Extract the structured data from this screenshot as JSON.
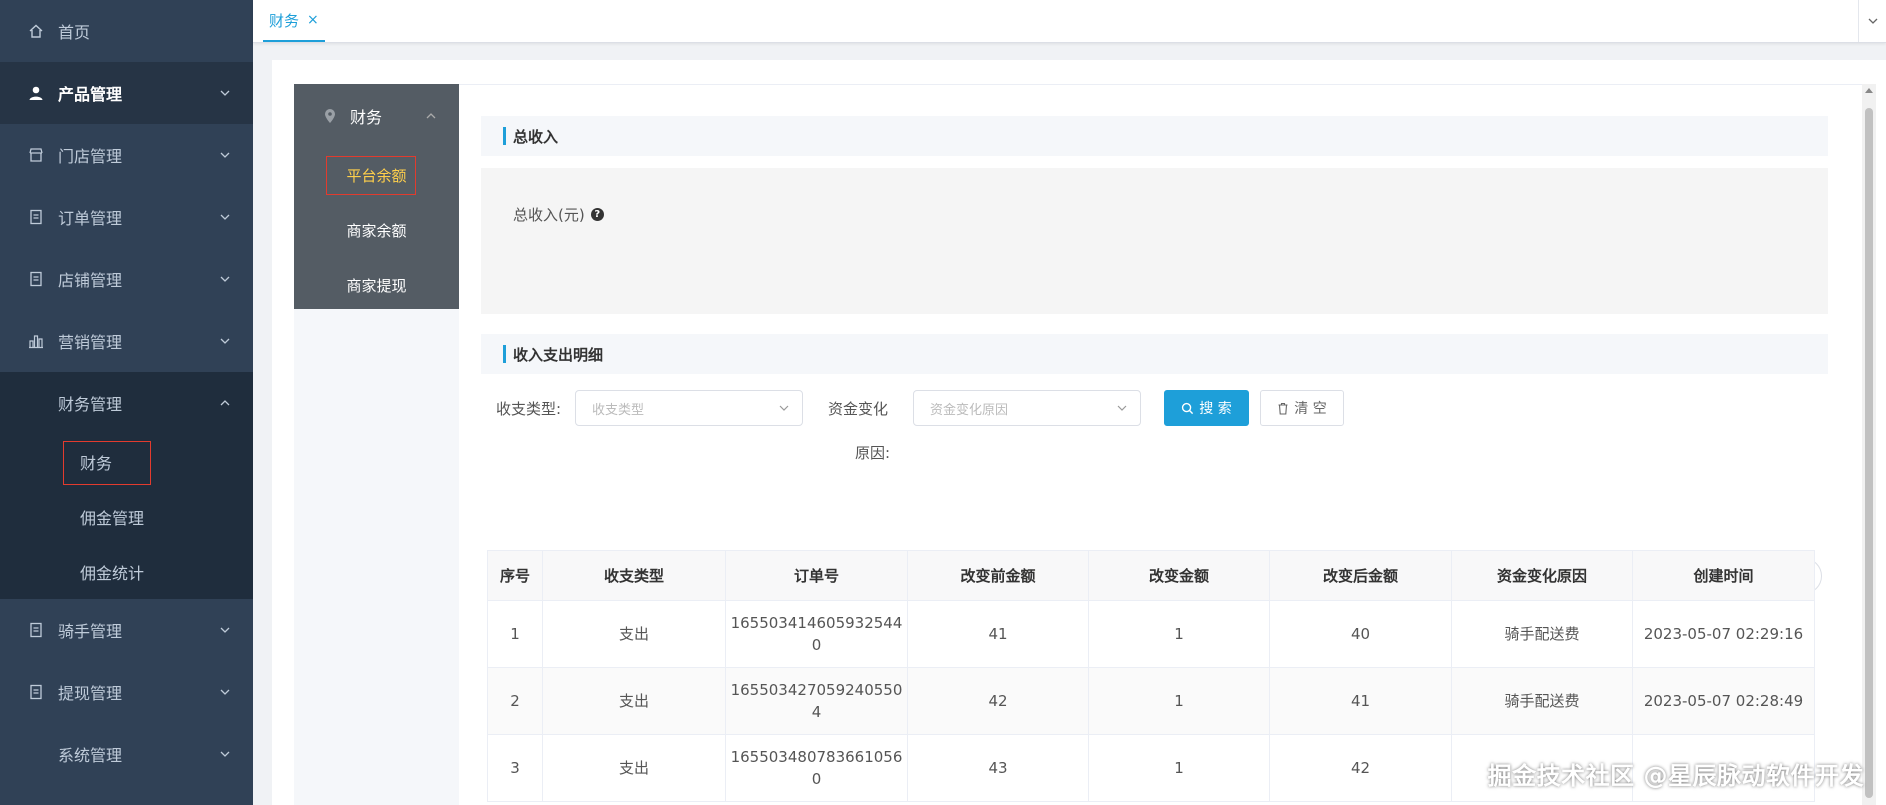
{
  "sidebar": {
    "items": [
      {
        "label": "首页",
        "icon": "home-icon"
      },
      {
        "label": "产品管理",
        "icon": "user-icon"
      },
      {
        "label": "门店管理",
        "icon": "store-icon"
      },
      {
        "label": "订单管理",
        "icon": "document-icon"
      },
      {
        "label": "店铺管理",
        "icon": "document-icon"
      },
      {
        "label": "营销管理",
        "icon": "bar-chart-icon"
      },
      {
        "label": "财务管理"
      },
      {
        "label": "骑手管理",
        "icon": "document-icon"
      },
      {
        "label": "提现管理",
        "icon": "document-icon"
      },
      {
        "label": "系统管理"
      }
    ],
    "finance_sub": [
      "财务",
      "佣金管理",
      "佣金统计"
    ]
  },
  "tabbar": {
    "tab_label": "财务",
    "close": "×"
  },
  "subnav": {
    "title": "财务",
    "items": [
      "平台余额",
      "商家余额",
      "商家提现"
    ]
  },
  "income": {
    "title": "总收入",
    "label": "总收入(元)",
    "help": "?"
  },
  "details": {
    "title": "收入支出明细",
    "filter_type_label": "收支类型:",
    "filter_type_placeholder": "收支类型",
    "filter_reason_label_1": "资金变化",
    "filter_reason_label_2": "原因:",
    "filter_reason_placeholder": "资金变化原因",
    "search_label": "搜 索",
    "clear_label": "清 空"
  },
  "table": {
    "headers": [
      "序号",
      "收支类型",
      "订单号",
      "改变前金额",
      "改变金额",
      "改变后金额",
      "资金变化原因",
      "创建时间"
    ],
    "rows": [
      {
        "idx": "1",
        "type": "支出",
        "order_a": "165503414605932544",
        "order_b": "0",
        "before": "41",
        "change": "1",
        "after": "40",
        "reason": "骑手配送费",
        "time": "2023-05-07 02:29:16"
      },
      {
        "idx": "2",
        "type": "支出",
        "order_a": "165503427059240550",
        "order_b": "4",
        "before": "42",
        "change": "1",
        "after": "41",
        "reason": "骑手配送费",
        "time": "2023-05-07 02:28:49"
      },
      {
        "idx": "3",
        "type": "支出",
        "order_a": "165503480783661056",
        "order_b": "0",
        "before": "43",
        "change": "1",
        "after": "42",
        "reason": "",
        "time": ""
      }
    ]
  },
  "watermark": "掘金技术社区 @星辰脉动软件开发",
  "colors": {
    "sidebar_bg": "#304156",
    "accent": "#1e9fd9",
    "subnav_active": "#ffd04b",
    "highlight_box": "#e23b2e"
  }
}
